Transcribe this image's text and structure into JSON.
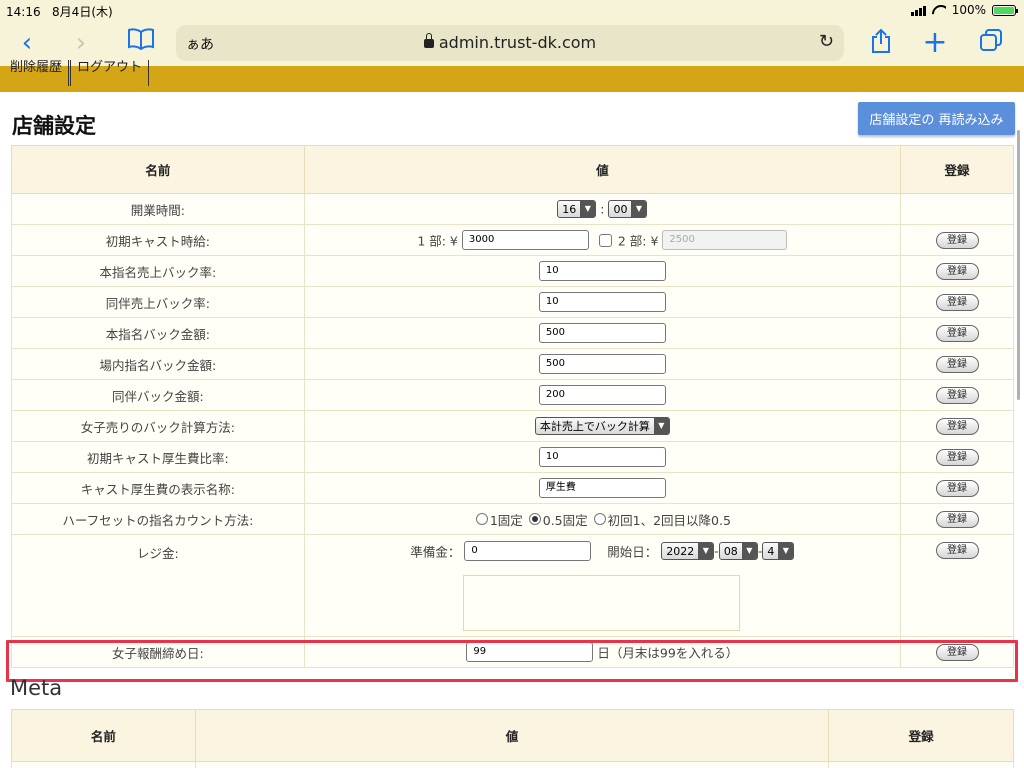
{
  "statusbar": {
    "time": "14:16",
    "date": "8月4日(木)",
    "battery_pct": "100%",
    "battery_level": 1.0
  },
  "browser": {
    "aa": "ぁあ",
    "url": "admin.trust-dk.com"
  },
  "nav": {
    "items": [
      "削除履歴",
      "ログアウト"
    ]
  },
  "page": {
    "title": "店舗設定",
    "reload_button": "店舗設定の 再読み込み"
  },
  "settings_table": {
    "headers": {
      "name": "名前",
      "value": "値",
      "register": "登録"
    },
    "register_label": "登録",
    "rows": {
      "open_time": {
        "label": "開業時間:",
        "hour": "16",
        "minute": "00"
      },
      "initial_wage": {
        "label": "初期キャスト時給:",
        "part1_label": "1 部: ¥",
        "part1_value": "3000",
        "part2_label": "2 部: ¥",
        "part2_value": "2500"
      },
      "nomination_back_rate": {
        "label": "本指名売上バック率:",
        "value": "10"
      },
      "douhan_back_rate": {
        "label": "同伴売上バック率:",
        "value": "10"
      },
      "nomination_back_amount": {
        "label": "本指名バック金額:",
        "value": "500"
      },
      "house_nomination_back_amount": {
        "label": "場内指名バック金額:",
        "value": "500"
      },
      "douhan_back_amount": {
        "label": "同伴バック金額:",
        "value": "200"
      },
      "girl_sales_method": {
        "label": "女子売りのバック計算方法:",
        "value": "本計売上でバック計算"
      },
      "welfare_ratio": {
        "label": "初期キャスト厚生費比率:",
        "value": "10"
      },
      "welfare_name": {
        "label": "キャスト厚生費の表示名称:",
        "value": "厚生費"
      },
      "halfset_count": {
        "label": "ハーフセットの指名カウント方法:",
        "options": [
          "1固定",
          "0.5固定",
          "初回1、2回目以降0.5"
        ],
        "selected": "0.5固定"
      },
      "register_cash": {
        "label": "レジ金:",
        "reserve_label": "準備金：",
        "reserve_value": "0",
        "start_label": "開始日：",
        "year": "2022",
        "month": "08",
        "day": "4",
        "sep": "-"
      },
      "girl_closing_day": {
        "label": "女子報酬締め日:",
        "value": "99",
        "suffix": "日（月末は99を入れる）"
      }
    }
  },
  "meta": {
    "title": "Meta",
    "headers": {
      "name": "名前",
      "value": "値",
      "register": "登録"
    }
  }
}
